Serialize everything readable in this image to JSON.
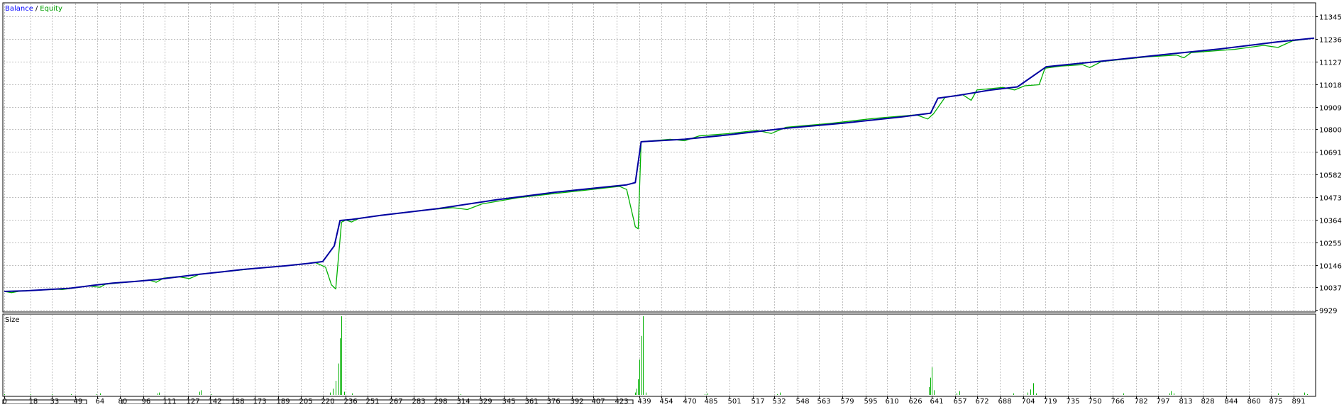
{
  "chart_data": {
    "type": "line",
    "panels": [
      {
        "name": "main",
        "legend": [
          "Balance",
          "Equity"
        ],
        "legend_separator": "/",
        "y_ticks": [
          9929,
          10037,
          10146,
          10255,
          10364,
          10473,
          10582,
          10691,
          10800,
          10909,
          11018,
          11127,
          11236,
          11345
        ],
        "ylim": [
          9929,
          11400
        ],
        "series": [
          {
            "name": "Balance",
            "color": "#0000a0",
            "points": [
              [
                0,
                10018
              ],
              [
                15,
                10021
              ],
              [
                30,
                10027
              ],
              [
                45,
                10033
              ],
              [
                60,
                10046
              ],
              [
                75,
                10058
              ],
              [
                90,
                10066
              ],
              [
                105,
                10075
              ],
              [
                120,
                10088
              ],
              [
                135,
                10101
              ],
              [
                150,
                10112
              ],
              [
                165,
                10124
              ],
              [
                180,
                10133
              ],
              [
                195,
                10142
              ],
              [
                210,
                10153
              ],
              [
                220,
                10162
              ],
              [
                228,
                10238
              ],
              [
                232,
                10360
              ],
              [
                240,
                10365
              ],
              [
                260,
                10385
              ],
              [
                300,
                10418
              ],
              [
                340,
                10460
              ],
              [
                380,
                10496
              ],
              [
                420,
                10525
              ],
              [
                430,
                10532
              ],
              [
                436,
                10543
              ],
              [
                440,
                10740
              ],
              [
                470,
                10752
              ],
              [
                500,
                10773
              ],
              [
                540,
                10805
              ],
              [
                580,
                10830
              ],
              [
                620,
                10860
              ],
              [
                640,
                10878
              ],
              [
                645,
                10950
              ],
              [
                660,
                10965
              ],
              [
                680,
                10988
              ],
              [
                700,
                11005
              ],
              [
                720,
                11102
              ],
              [
                760,
                11130
              ],
              [
                800,
                11160
              ],
              [
                840,
                11188
              ],
              [
                880,
                11222
              ],
              [
                905,
                11240
              ]
            ]
          },
          {
            "name": "Equity",
            "color": "#00b000",
            "points": [
              [
                0,
                10018
              ],
              [
                5,
                10012
              ],
              [
                12,
                10021
              ],
              [
                25,
                10024
              ],
              [
                32,
                10030
              ],
              [
                40,
                10027
              ],
              [
                50,
                10036
              ],
              [
                58,
                10045
              ],
              [
                66,
                10038
              ],
              [
                70,
                10053
              ],
              [
                90,
                10066
              ],
              [
                100,
                10073
              ],
              [
                105,
                10062
              ],
              [
                110,
                10082
              ],
              [
                120,
                10089
              ],
              [
                128,
                10080
              ],
              [
                135,
                10101
              ],
              [
                155,
                10115
              ],
              [
                170,
                10126
              ],
              [
                185,
                10136
              ],
              [
                200,
                10145
              ],
              [
                215,
                10157
              ],
              [
                222,
                10135
              ],
              [
                226,
                10050
              ],
              [
                229,
                10030
              ],
              [
                233,
                10352
              ],
              [
                236,
                10362
              ],
              [
                240,
                10353
              ],
              [
                245,
                10370
              ],
              [
                260,
                10385
              ],
              [
                290,
                10410
              ],
              [
                310,
                10422
              ],
              [
                320,
                10413
              ],
              [
                330,
                10440
              ],
              [
                355,
                10470
              ],
              [
                380,
                10490
              ],
              [
                400,
                10505
              ],
              [
                425,
                10525
              ],
              [
                430,
                10510
              ],
              [
                433,
                10420
              ],
              [
                436,
                10330
              ],
              [
                438,
                10320
              ],
              [
                440,
                10740
              ],
              [
                460,
                10752
              ],
              [
                470,
                10745
              ],
              [
                480,
                10768
              ],
              [
                500,
                10779
              ],
              [
                520,
                10795
              ],
              [
                530,
                10780
              ],
              [
                540,
                10810
              ],
              [
                570,
                10828
              ],
              [
                600,
                10852
              ],
              [
                630,
                10870
              ],
              [
                638,
                10850
              ],
              [
                642,
                10875
              ],
              [
                650,
                10955
              ],
              [
                662,
                10968
              ],
              [
                668,
                10940
              ],
              [
                672,
                10990
              ],
              [
                690,
                11002
              ],
              [
                698,
                10990
              ],
              [
                705,
                11010
              ],
              [
                715,
                11015
              ],
              [
                719,
                11095
              ],
              [
                730,
                11105
              ],
              [
                745,
                11112
              ],
              [
                750,
                11098
              ],
              [
                758,
                11127
              ],
              [
                790,
                11150
              ],
              [
                810,
                11158
              ],
              [
                815,
                11145
              ],
              [
                820,
                11170
              ],
              [
                850,
                11186
              ],
              [
                870,
                11205
              ],
              [
                880,
                11195
              ],
              [
                890,
                11227
              ],
              [
                905,
                11240
              ]
            ]
          }
        ]
      },
      {
        "name": "size",
        "label": "Size",
        "bars": [
          [
            0,
            1
          ],
          [
            18,
            1
          ],
          [
            33,
            1
          ],
          [
            46,
            1
          ],
          [
            63,
            1
          ],
          [
            66,
            2
          ],
          [
            106,
            2
          ],
          [
            107,
            3
          ],
          [
            135,
            4
          ],
          [
            136,
            6
          ],
          [
            143,
            1
          ],
          [
            225,
            3
          ],
          [
            227,
            8
          ],
          [
            229,
            18
          ],
          [
            231,
            40
          ],
          [
            232,
            72
          ],
          [
            233,
            100
          ],
          [
            235,
            4
          ],
          [
            240,
            2
          ],
          [
            315,
            1
          ],
          [
            436,
            3
          ],
          [
            437,
            8
          ],
          [
            438,
            20
          ],
          [
            439,
            45
          ],
          [
            440,
            75
          ],
          [
            441,
            100
          ],
          [
            443,
            3
          ],
          [
            484,
            1
          ],
          [
            486,
            2
          ],
          [
            534,
            1
          ],
          [
            536,
            3
          ],
          [
            639,
            10
          ],
          [
            640,
            22
          ],
          [
            641,
            35
          ],
          [
            642,
            6
          ],
          [
            658,
            2
          ],
          [
            660,
            5
          ],
          [
            697,
            2
          ],
          [
            707,
            3
          ],
          [
            709,
            7
          ],
          [
            711,
            15
          ],
          [
            713,
            2
          ],
          [
            773,
            2
          ],
          [
            805,
            2
          ],
          [
            806,
            5
          ],
          [
            808,
            2
          ],
          [
            880,
            2
          ],
          [
            898,
            3
          ],
          [
            900,
            1
          ]
        ],
        "max": 100
      }
    ],
    "x_ticks": [
      0,
      18,
      33,
      49,
      64,
      80,
      96,
      111,
      127,
      142,
      158,
      173,
      189,
      205,
      220,
      236,
      251,
      267,
      283,
      298,
      314,
      329,
      345,
      361,
      376,
      392,
      407,
      423,
      439,
      454,
      470,
      485,
      501,
      517,
      532,
      548,
      563,
      579,
      595,
      610,
      626,
      641,
      657,
      672,
      688,
      704,
      719,
      735,
      750,
      766,
      782,
      797,
      813,
      828,
      844,
      860,
      875,
      891
    ],
    "xlim": [
      0,
      905
    ],
    "grid": true
  },
  "colors": {
    "background": "#ffffff",
    "grid": "#c0c0c0",
    "frame": "#000000",
    "bars": "#00b000"
  }
}
